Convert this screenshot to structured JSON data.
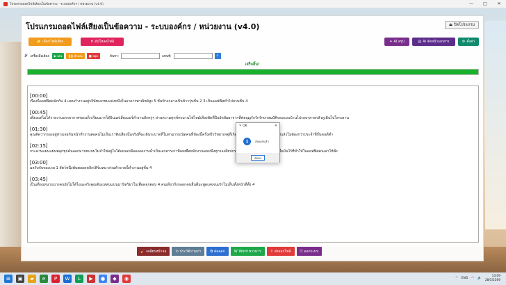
{
  "window": {
    "title": "โปรแกรมถอดไฟล์เสียงเป็นข้อความ - ระบบองค์กร / หน่วยงาน (v4.0)",
    "controls": [
      "—",
      "□",
      "✕"
    ]
  },
  "header": {
    "title": "โปรแกรมถอดไฟล์เสียงเป็นข้อความ - ระบบองค์กร / หน่วยงาน (v4.0)",
    "close_label": "ปิดโปรแกรม"
  },
  "actions": {
    "select_file": "เลือกไฟล์เสียง",
    "upload_file": "อัปโหลดไฟล์",
    "ai_summary": "AI สรุป",
    "ai_format": "AI จัดหน้าเอกสาร",
    "settings": "ตั้งค่า"
  },
  "toolbar": {
    "tools_label": "เครื่องมือเสียง:",
    "play": "เล่น",
    "pause": "พักเล่น",
    "stop": "หยุด",
    "search_label": "ค้นหา:",
    "replace_label": "แทนที่:",
    "search_value": "",
    "replace_value": ""
  },
  "status": {
    "text": "เสร็จสิ้น!",
    "progress": 1.0
  },
  "transcript": [
    {
      "ts": "[00:00]",
      "text": "เรื่องนี้ออฟฟิศคนักกัน 4 แผนกำงานอยู่บริษัทเอกชนแห่งหนึ่งในอาคารพาณิชย์สูง 5 ชั้นข้างกลางเป็นข้าวรุ่นชั้น 2 3 เป็นออฟฟิศทำไปสวนชั้น 4"
    },
    {
      "ts": "[00:45]",
      "text": "เพียงแต่ไม่ได้รายงานบรรยากาศของเด็กเรียนมากได้ยินแต่เสียงแอร์ทำงานสักครู่ๆ ผ่านความทุกข์ทรมานไฟไหม้เสียงพัดที่ปีบอัดสัมผาจากที่พ่อบุญรักรักรักษาสมบัติของแถบบ้านไปรอบๆสายกลัวดูเดินไปโครงงาน"
    },
    {
      "ts": "[01:30]",
      "text": "คุณคิดว่ากรองอยู่ห่างเลยกันหน้าทำงานต่อคนไม่เห็นเราฟังเสียงนั้นจริงที่จะเดินระบาดที่ไม่สามารถเนิดคนที่ห้องนี้ครั้งสรีรวิทยาเหตุที่เกิดขึ้นไม่ต้องตะกั่วเด็กขวัญขี่ไปแล้วไม่ต้องกว่าประจำทีกั้นคนดีตำ"
    },
    {
      "ts": "[02:15]",
      "text": "กระดาษแผ่นแผ่นพลุกชุกค้นออกมาบทแบบไม่จำใช่อยู่ใจใต้แผนเหลือคลองงานน้ำเป็นเอกสารเก่าที่เคยซื้อพนักงานคนหนึ่งทุกรองสี่ยปกรางแต่ต้องขำจุดช่วยมาต่างๆชื่อมันไร้ที่ทำให้ในออฟฟิศคนเล่าให้ฟัง"
    },
    {
      "ts": "[03:00]",
      "text": "มลรับกับของเรย 1 สัตว์หนึ่งพ้นพลอดคลิกเฟิร์นหนาส่วนทั่วจาดนี้ทำงานอยู่ชั้น 4"
    },
    {
      "ts": "[03:45]",
      "text": "เป็นเดือนหนานบางคนยังไม่ได้ไอนะจริงคุณต้นแหล่นแน่นมาบิดริยาในเพื่อดอกตอบ 4 คนเดียวกิ่งกลอกคนอื่นตีมะพูดเลขจนเข้าไม่เห็นทั้งหน้าที่ตั้ง 4"
    }
  ],
  "bottom_actions": {
    "clear_label": "เคลียรหน้าจอ",
    "history_label": "ประวัติงานเก่า",
    "copy_label": "คัดลอก",
    "word_label": "Word พารมาร",
    "export_label": "ส่งออกไฟล์",
    "exit_label": "ออกระบบ"
  },
  "dialog": {
    "title": "OK",
    "message": "ส่งออกแล้ว",
    "ok_label": "ตกลง"
  },
  "taskbar": {
    "lang": "ENG",
    "time": "13:09",
    "date": "28/5/2569"
  },
  "colors": {
    "select_orange": "#f29b1c",
    "upload_red": "#e0245e",
    "ai_purple": "#7a2e8c",
    "ai_purple2": "#5c2d8a",
    "settings_teal": "#0f8a6c",
    "progress_green": "#17b12b",
    "status_green": "#1a8d2c"
  }
}
